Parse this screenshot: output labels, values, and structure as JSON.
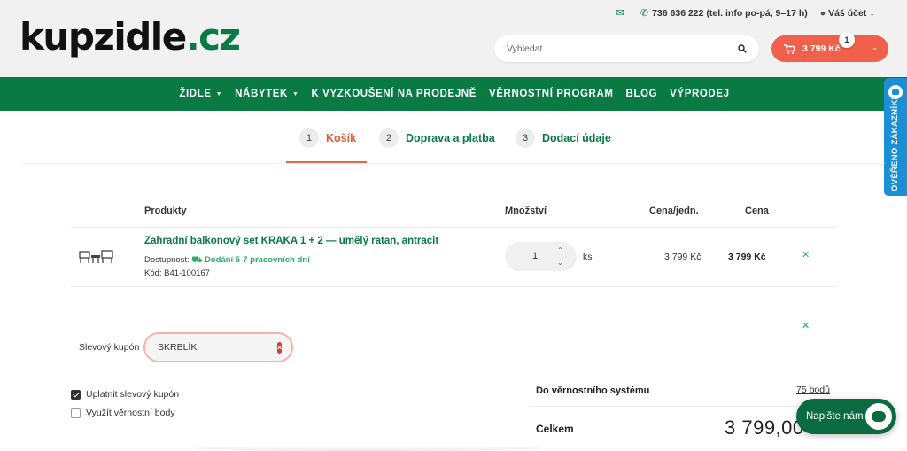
{
  "header": {
    "logo_main": "kupzidle",
    "logo_tld": ".cz",
    "phone": "736 636 222 (tel. info po-pá, 9–17 h)",
    "account": "Váš účet",
    "search_placeholder": "Vyhledat",
    "cart_total": "3 799 Kč",
    "cart_count": "1"
  },
  "nav": {
    "items": [
      {
        "label": "ŽIDLE",
        "has_dropdown": true
      },
      {
        "label": "NÁBYTEK",
        "has_dropdown": true
      },
      {
        "label": "K VYZKOUŠENÍ NA PRODEJNĚ",
        "has_dropdown": false
      },
      {
        "label": "VĚRNOSTNÍ PROGRAM",
        "has_dropdown": false
      },
      {
        "label": "BLOG",
        "has_dropdown": false
      },
      {
        "label": "VÝPRODEJ",
        "has_dropdown": false
      }
    ]
  },
  "verified_badge": "OVĚŘENO ZÁKAZNÍKY",
  "steps": [
    {
      "num": "1",
      "label": "Košík",
      "active": true
    },
    {
      "num": "2",
      "label": "Doprava a platba",
      "active": false
    },
    {
      "num": "3",
      "label": "Dodací údaje",
      "active": false
    }
  ],
  "table": {
    "headers": {
      "product": "Produkty",
      "quantity": "Množství",
      "unit_price": "Cena/jedn.",
      "price": "Cena"
    },
    "rows": [
      {
        "name": "Zahradní balkonový set KRAKA 1 + 2 — umělý ratan, antracit",
        "availability_label": "Dostupnost:",
        "availability_value": "Dodání 5-7 pracovních dní",
        "code": "Kód: B41-100167",
        "quantity": "1",
        "unit": "ks",
        "unit_price": "3 799 Kč",
        "price": "3 799 Kč"
      }
    ]
  },
  "coupon": {
    "label": "Slevový kupón",
    "value": "SKRBLÍK"
  },
  "options": {
    "apply_coupon": {
      "label": "Uplatnit slevový kupón",
      "checked": true
    },
    "use_points": {
      "label": "Využít věrnostní body",
      "checked": false
    }
  },
  "summary": {
    "loyalty_label": "Do věrnostního systému",
    "loyalty_points": "75 bodů",
    "total_label": "Celkem",
    "total_value": "3 799,00 Kč"
  },
  "chat": {
    "label": "Napište nám"
  },
  "colors": {
    "brand_green": "#0a7a45",
    "accent_orange": "#f0604a",
    "badge_blue": "#1a8fd6"
  }
}
